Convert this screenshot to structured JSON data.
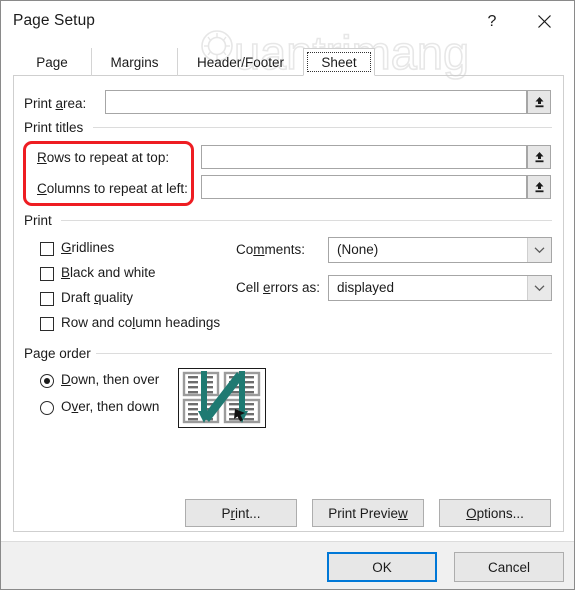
{
  "window": {
    "title": "Page Setup",
    "help_icon": "question-mark-icon",
    "help_label": "?",
    "close_icon": "close-icon",
    "watermark_text": "Quantrimang"
  },
  "tabs": [
    {
      "label": "Page",
      "active": false
    },
    {
      "label": "Margins",
      "active": false
    },
    {
      "label": "Header/Footer",
      "active": false
    },
    {
      "label": "Sheet",
      "active": true
    }
  ],
  "sheet": {
    "print_area": {
      "label_pre": "Print ",
      "label_accel": "a",
      "label_post": "rea:",
      "value": "",
      "placeholder": "",
      "range_button_icon": "collapse-dialog-icon"
    },
    "print_titles": {
      "group_label": "Print titles",
      "rows_to_repeat": {
        "label_accel": "R",
        "label_post": "ows to repeat at top:",
        "value": "",
        "range_button_icon": "collapse-dialog-icon"
      },
      "columns_to_repeat": {
        "label_accel": "C",
        "label_post": "olumns to repeat at left:",
        "value": "",
        "range_button_icon": "collapse-dialog-icon"
      }
    },
    "print": {
      "group_label": "Print",
      "checkboxes": [
        {
          "accel": "G",
          "post": "ridlines",
          "checked": false
        },
        {
          "accel": "B",
          "post": "lack and white",
          "checked": false
        },
        {
          "pre": "Draft ",
          "accel": "q",
          "post": "uality",
          "checked": false
        },
        {
          "pre": "Row and co",
          "accel": "l",
          "post": "umn headings",
          "checked": false
        }
      ],
      "comments": {
        "label_pre": "Co",
        "label_accel": "m",
        "label_post": "ments:",
        "value": "(None)",
        "arrow_icon": "chevron-down-icon"
      },
      "cell_errors": {
        "label_pre": "Cell ",
        "label_accel": "e",
        "label_post": "rrors as:",
        "value": "displayed",
        "arrow_icon": "chevron-down-icon"
      }
    },
    "page_order": {
      "group_label": "Page order",
      "options": [
        {
          "accel": "D",
          "post": "own, then over",
          "selected": true
        },
        {
          "pre": "O",
          "accel": "v",
          "post": "er, then down",
          "selected": false
        }
      ],
      "preview_icon": "page-order-preview-icon",
      "preview_arrow_color": "#1f7a72"
    }
  },
  "action_buttons": [
    {
      "pre": "P",
      "accel": "r",
      "post": "int..."
    },
    {
      "pre": "Print Previe",
      "accel": "w",
      "post": ""
    },
    {
      "pre": "",
      "accel": "O",
      "post": "ptions..."
    }
  ],
  "footer_buttons": [
    {
      "label": "OK",
      "focused": true
    },
    {
      "label": "Cancel",
      "focused": false
    }
  ],
  "colors": {
    "accent_blue": "#0078d7",
    "annotation_red": "#ee1d22",
    "teal_arrow": "#1f7a72",
    "dialog_bg": "#ffffff",
    "footer_bg": "#f0f0f0"
  }
}
